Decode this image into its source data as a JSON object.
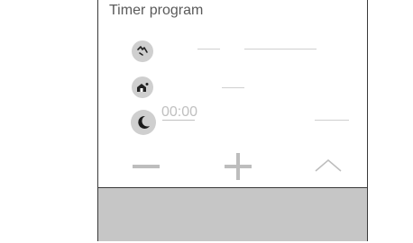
{
  "panel": {
    "title": "Timer program",
    "time_value": "00:00"
  },
  "icons": {
    "row1": "comfort-temperature-icon",
    "row2": "home-person-icon",
    "row3": "moon-night-icon",
    "decrease": "minus-icon",
    "increase": "plus-icon",
    "collapse": "chevron-up-icon"
  },
  "colors": {
    "icon_bg": "#cfcfcf",
    "icon_fg": "#222222",
    "line_gray": "#cfcfcf",
    "footer_bg": "#c6c6c6",
    "control_gray": "#bdbdbd"
  }
}
